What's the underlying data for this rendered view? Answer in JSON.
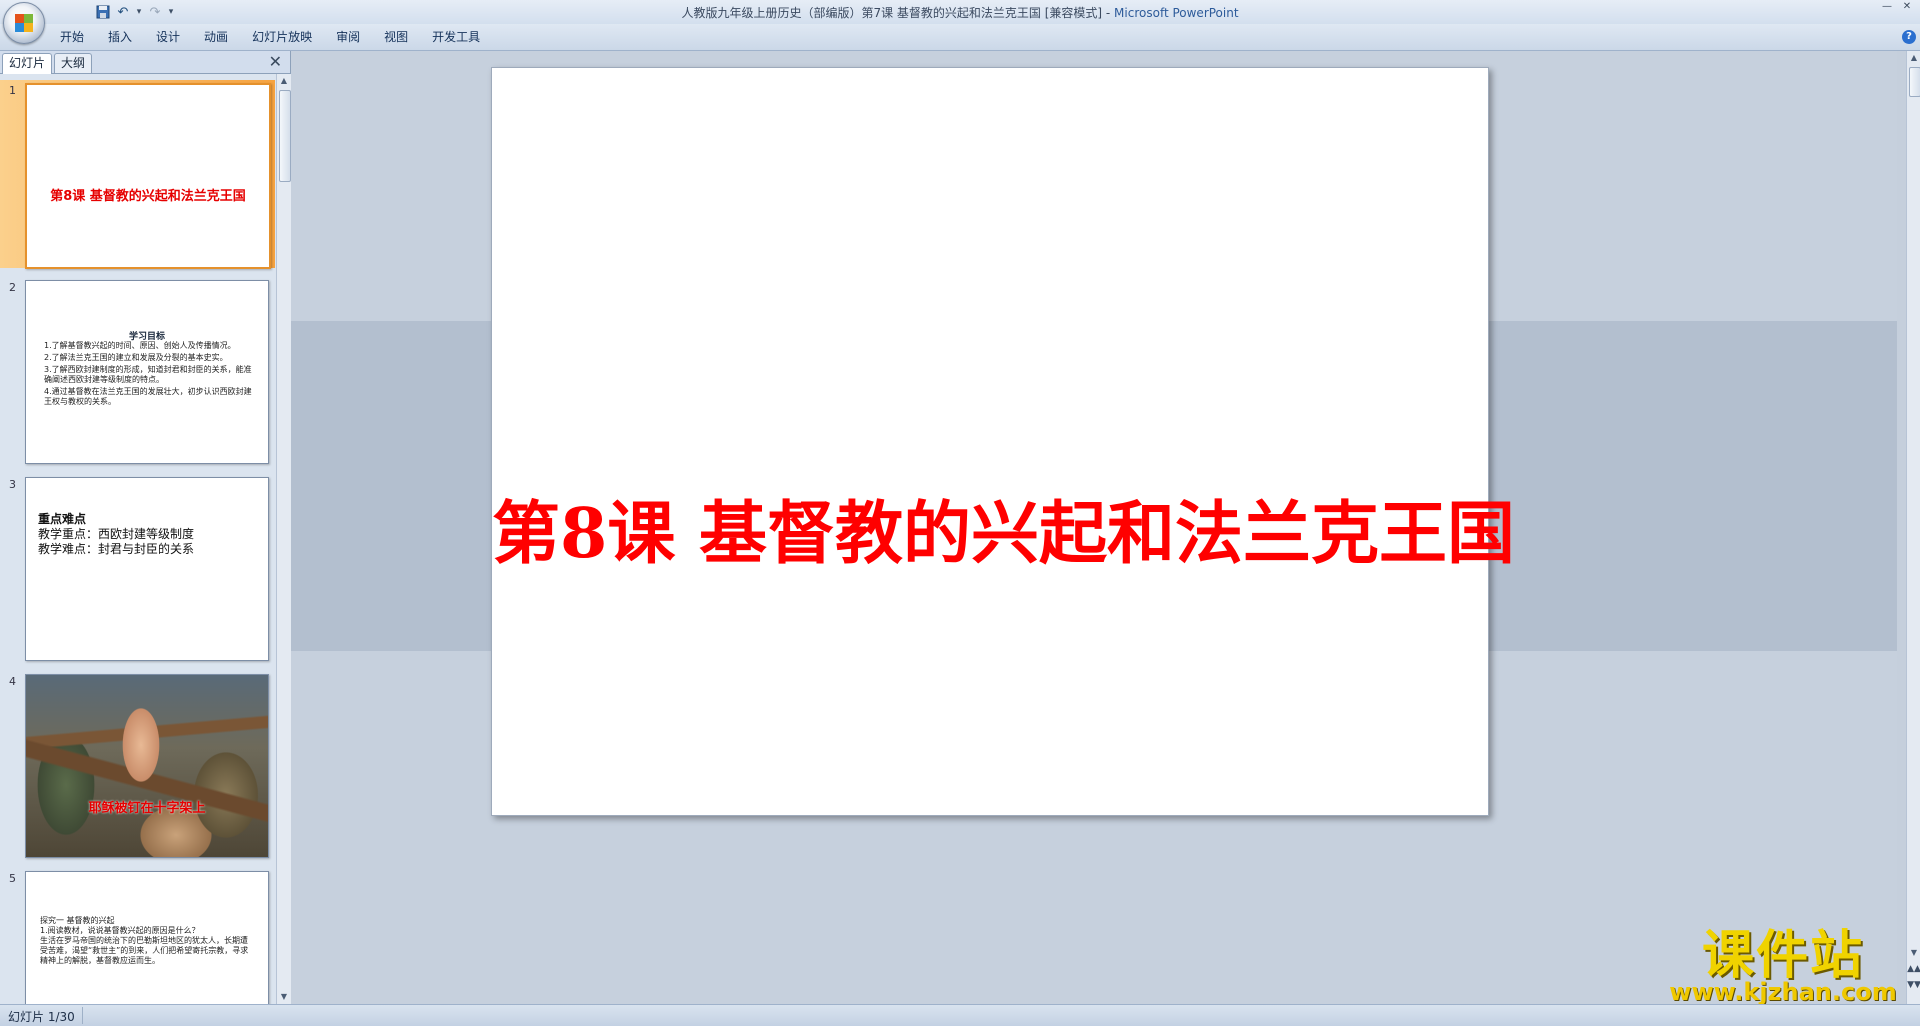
{
  "window": {
    "title": "人教版九年级上册历史（部编版）第7课  基督教的兴起和法兰克王国 [兼容模式]",
    "app": "Microsoft PowerPoint"
  },
  "quick_access": {
    "icons": [
      "save-icon",
      "undo-icon",
      "redo-icon",
      "customize-dropdown-icon"
    ]
  },
  "ribbon": {
    "tabs": [
      "开始",
      "插入",
      "设计",
      "动画",
      "幻灯片放映",
      "审阅",
      "视图",
      "开发工具"
    ]
  },
  "panel": {
    "tabs": [
      "幻灯片",
      "大纲"
    ],
    "active_tab": "幻灯片"
  },
  "thumbnails": [
    {
      "num": "1",
      "title": "第8课  基督教的兴起和法兰克王国",
      "selected": true
    },
    {
      "num": "2",
      "heading": "学习目标",
      "items": [
        "1.了解基督教兴起的时间、原因、创始人及传播情况。",
        "2.了解法兰克王国的建立和发展及分裂的基本史实。",
        "3.了解西欧封建制度的形成，知道封君和封臣的关系，能准确阐述西欧封建等级制度的特点。",
        "4.通过基督教在法兰克王国的发展壮大，初步认识西欧封建王权与教权的关系。"
      ]
    },
    {
      "num": "3",
      "lines": [
        "重点难点",
        "教学重点：西欧封建等级制度",
        "教学难点：封君与封臣的关系"
      ]
    },
    {
      "num": "4",
      "title": "耶稣被钉在十字架上"
    },
    {
      "num": "5",
      "lines": [
        "探究一  基督教的兴起",
        "1.阅读教材，说说基督教兴起的原因是什么？",
        "生活在罗马帝国的统治下的巴勒斯坦地区的犹太人，长期遭受苦难，渴望“救世主”的到来，人们把希望寄托宗教，寻求精神上的解脱，基督教应运而生。"
      ]
    }
  ],
  "slide": {
    "title": "第8课  基督教的兴起和法兰克王国",
    "title_color": "#ff0000"
  },
  "watermark": {
    "cn": "课件站",
    "url": "www.kjzhan.com"
  },
  "status": {
    "slide_indicator": "幻灯片 1/30"
  }
}
